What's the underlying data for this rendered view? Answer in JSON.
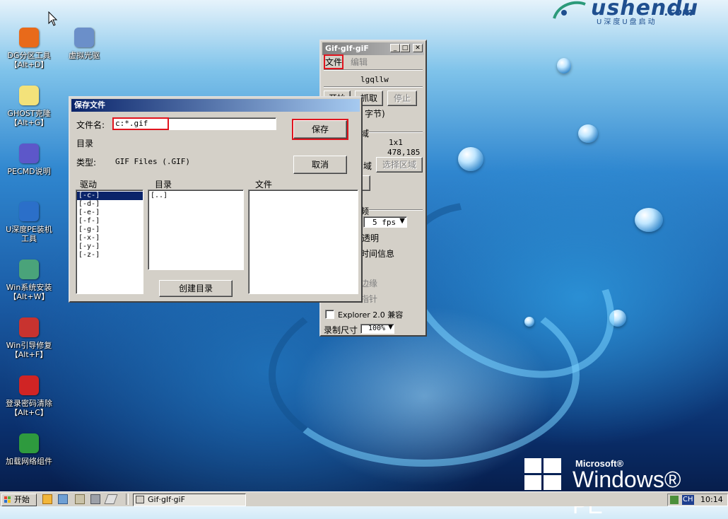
{
  "desktop": {
    "brand": {
      "name": "ushendu",
      "domain": ".com",
      "tagline": "U深度U盘启动"
    },
    "os_logo": {
      "company": "Microsoft®",
      "product": "Windows® PE"
    },
    "icons": [
      {
        "label": "DG分区工具\n【Alt+D】",
        "icon": "partition-tool-icon",
        "color": "#e86a1a"
      },
      {
        "label": "虚拟光驱",
        "icon": "virtual-drive-icon",
        "color": "#6b8fc9"
      },
      {
        "label": "GHOST克隆\n【Alt+G】",
        "icon": "ghost-icon",
        "color": "#f3e27a"
      },
      {
        "label": "PECMD说明",
        "icon": "help-icon",
        "color": "#5d57c9"
      },
      {
        "label": "U深度PE装机\n工具",
        "icon": "installer-icon",
        "color": "#2b6fc9"
      },
      {
        "label": "Win系统安装\n【Alt+W】",
        "icon": "system-install-icon",
        "color": "#4aa37a"
      },
      {
        "label": "Win引导修复\n【Alt+F】",
        "icon": "boot-repair-icon",
        "color": "#c8332f"
      },
      {
        "label": "登录密码清除\n【Alt+C】",
        "icon": "password-clear-icon",
        "color": "#d02424"
      },
      {
        "label": "加载网络组件",
        "icon": "network-icon",
        "color": "#2e9a3e"
      }
    ]
  },
  "gif_window": {
    "title": "Gif·gIf·giF",
    "menu": [
      "文件",
      "编辑"
    ],
    "filename": "lgqllw",
    "buttons": {
      "start": "开始",
      "capture": "抓取",
      "stop": "停止",
      "select_region": "选择区域"
    },
    "bytes_label": "字节)",
    "group_label_1": "域",
    "size_value": "1x1",
    "coords_value": "478,185",
    "region_label": "域",
    "fps_value": "5 fps",
    "label_transparent": "透明",
    "label_time": "时间信息",
    "label_edge": "边缘",
    "label_pointer": "指针",
    "explorer_label": "Explorer 2.0 兼容",
    "scale_label": "录制尺寸",
    "scale_value": "100%",
    "frame_label": "频"
  },
  "save_dialog": {
    "title": "保存文件",
    "filename_label": "文件名:",
    "filename_value": "c:*.gif",
    "save_button": "保存",
    "cancel_button": "取消",
    "directory_label": "目录",
    "type_label": "类型:",
    "type_value": "GIF Files (.GIF)",
    "drives_header": "驱动",
    "dirs_header": "目录",
    "files_header": "文件",
    "drives": [
      "[-c-]",
      "[-d-]",
      "[-e-]",
      "[-f-]",
      "[-g-]",
      "[-x-]",
      "[-y-]",
      "[-z-]"
    ],
    "selected_drive_index": 0,
    "directories": [
      "[..]"
    ],
    "files": [],
    "create_dir_button": "创建目录"
  },
  "taskbar": {
    "start_label": "开始",
    "task_title": "Gif·gIf·giF",
    "tray_lang": "CH",
    "clock": "10:14"
  },
  "colors": {
    "accent": "#0a246a",
    "highlight_box": "#e0141e",
    "window_bg": "#d4d0c8"
  }
}
